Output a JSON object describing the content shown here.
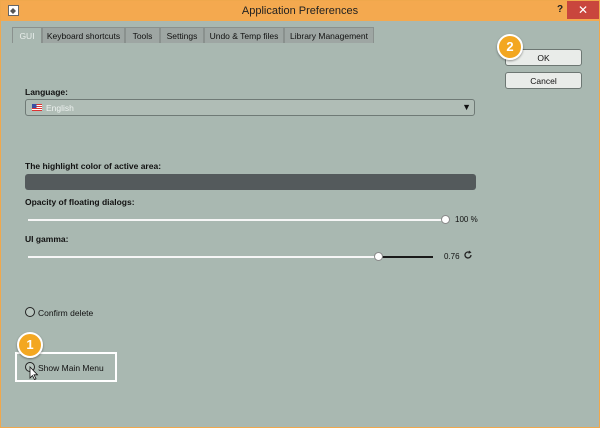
{
  "window": {
    "title": "Application Preferences",
    "help": "?",
    "close": "✕"
  },
  "tabs": [
    {
      "label": "GUI",
      "active": true
    },
    {
      "label": "Keyboard shortcuts"
    },
    {
      "label": "Tools"
    },
    {
      "label": "Settings"
    },
    {
      "label": "Undo & Temp files"
    },
    {
      "label": "Library Management"
    }
  ],
  "language": {
    "label": "Language:",
    "value": "English",
    "arrow": "▼"
  },
  "highlight": {
    "label": "The highlight color of active area:",
    "color": "#545a5c"
  },
  "opacity": {
    "label": "Opacity of floating dialogs:",
    "value_text": "100 %",
    "value": 1.0
  },
  "gamma": {
    "label": "UI gamma:",
    "value_text": "0.76",
    "fraction": 0.86
  },
  "confirm_delete": {
    "label": "Confirm delete"
  },
  "show_main_menu": {
    "label": "Show Main Menu"
  },
  "buttons": {
    "ok": "OK",
    "cancel": "Cancel"
  },
  "callouts": {
    "step1": "1",
    "step2": "2"
  },
  "colors": {
    "titlebar": "#f4a94f",
    "background": "#a9b8b1",
    "badge": "#f3a721",
    "close": "#c9463d"
  }
}
